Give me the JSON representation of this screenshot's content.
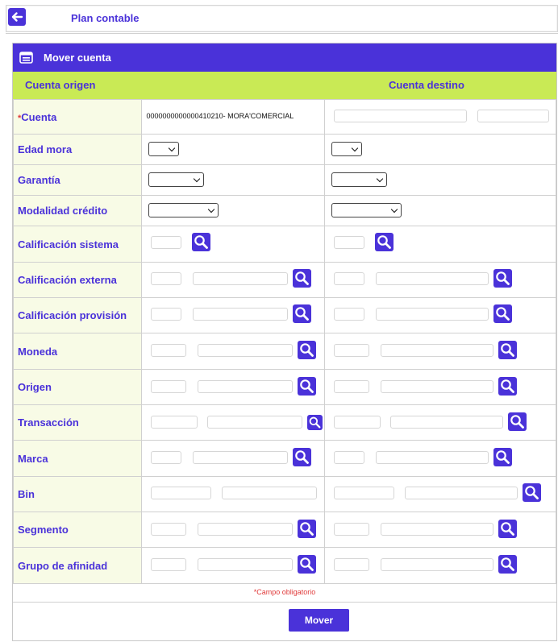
{
  "topbar": {
    "title": "Plan contable"
  },
  "panel": {
    "title": "Mover cuenta"
  },
  "columns": {
    "origin": "Cuenta origen",
    "destination": "Cuenta destino"
  },
  "rows": {
    "cuenta": {
      "required_mark": "*",
      "label": "Cuenta",
      "origin_value": "0000000000000410210- MORA'COMERCIAL"
    },
    "edad_mora": {
      "label": "Edad mora"
    },
    "garantia": {
      "label": "Garantía"
    },
    "modalidad": {
      "label": "Modalidad crédito"
    },
    "calif_sistema": {
      "label": "Calificación sistema"
    },
    "calif_externa": {
      "label": "Calificación externa"
    },
    "calif_provision": {
      "label": "Calificación provisión"
    },
    "moneda": {
      "label": "Moneda"
    },
    "origen": {
      "label": "Origen"
    },
    "transaccion": {
      "label": "Transacción"
    },
    "marca": {
      "label": "Marca"
    },
    "bin": {
      "label": "Bin"
    },
    "segmento": {
      "label": "Segmento"
    },
    "grupo_afinidad": {
      "label": "Grupo de afinidad"
    }
  },
  "footer": {
    "required_mark": "*",
    "required_note": "Campo obligatorio",
    "move_label": "Mover"
  },
  "icons": {
    "back": "arrow-left-icon",
    "panel": "form-icon",
    "search": "magnifier-icon"
  },
  "colors": {
    "accent": "#4a32d9",
    "header_bar": "#c9ea55",
    "label_bg": "#f8fbe6",
    "required": "#e03a3a"
  }
}
